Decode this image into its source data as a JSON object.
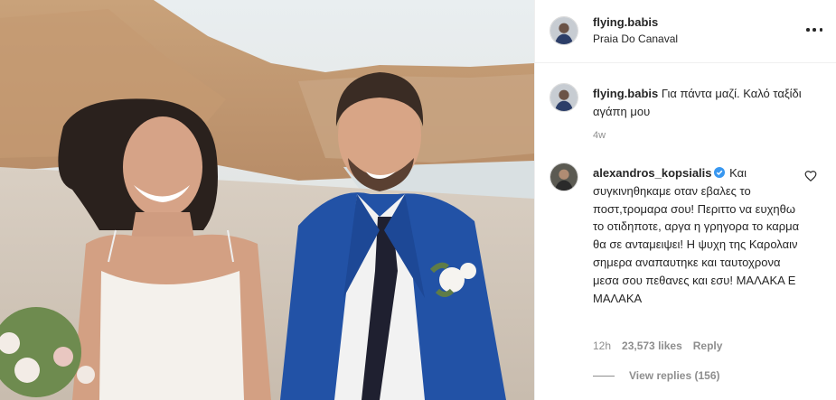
{
  "header": {
    "username": "flying.babis",
    "location": "Praia Do Canaval",
    "more_icon": "more-horizontal-icon"
  },
  "caption": {
    "username": "flying.babis",
    "text": "Για πάντα μαζί. Καλό ταξίδι αγάπη μου",
    "time": "4w"
  },
  "comment": {
    "username": "alexandros_kopsialis",
    "text": "Και συγκινηθηκαμε οταν εβαλες το ποστ,τρομαρα σου! Περιττο να ευχηθω το οτιδηποτε, αργα η γρηγορα το καρμα θα σε ανταμειψει! Η ψυχη της Καρολαιν σημερα αναπαυτηκε και ταυτοχρονα μεσα σου πεθανες και εσυ! ΜΑΛΑΚΑ Ε ΜΑΛΑΚΑ",
    "time": "12h",
    "likes": "23,573 likes",
    "reply": "Reply",
    "view_replies": "View replies (156)",
    "verified_icon": "verified-badge-icon",
    "heart_icon": "heart-outline-icon"
  },
  "colors": {
    "text": "#262626",
    "secondary": "#8e8e8e",
    "border": "#efefef",
    "verified": "#3897f0",
    "jacket": "#2252a6"
  }
}
